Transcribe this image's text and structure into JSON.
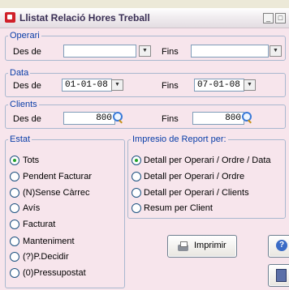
{
  "window": {
    "title": "Llistat Relació Hores Treball",
    "min_glyph": "_",
    "max_glyph": "□"
  },
  "operari": {
    "legend": "Operari",
    "from_label": "Des de",
    "from_value": "",
    "to_label": "Fins",
    "to_value": ""
  },
  "data": {
    "legend": "Data",
    "from_label": "Des de",
    "from_value": "01-01-08",
    "to_label": "Fins",
    "to_value": "07-01-08"
  },
  "clients": {
    "legend": "Clients",
    "from_label": "Des de",
    "from_value": "800",
    "to_label": "Fins",
    "to_value": "800"
  },
  "estat": {
    "legend": "Estat",
    "options": [
      "Tots",
      "Pendent Facturar",
      "(N)Sense Càrrec",
      "Avís",
      "Facturat",
      "Manteniment",
      "(?)P.Decidir",
      "(0)Pressupostat"
    ],
    "selected": "Tots"
  },
  "report": {
    "legend": "Impresio de Report per:",
    "options": [
      "Detall per Operari / Ordre / Data",
      "Detall per Operari / Ordre",
      "Detall per Operari / Clients",
      "Resum per Client"
    ],
    "selected": "Detall per Operari / Ordre / Data"
  },
  "actions": {
    "print_label": "Imprimir"
  },
  "colors": {
    "accent": "#0a3ea8",
    "title_text": "#3a2f55",
    "window_bg": "#f7e5ec"
  },
  "icons": [
    "app-icon",
    "dropdown-arrow-icon",
    "magnifier-icon",
    "printer-icon",
    "help-icon",
    "exit-door-icon"
  ]
}
